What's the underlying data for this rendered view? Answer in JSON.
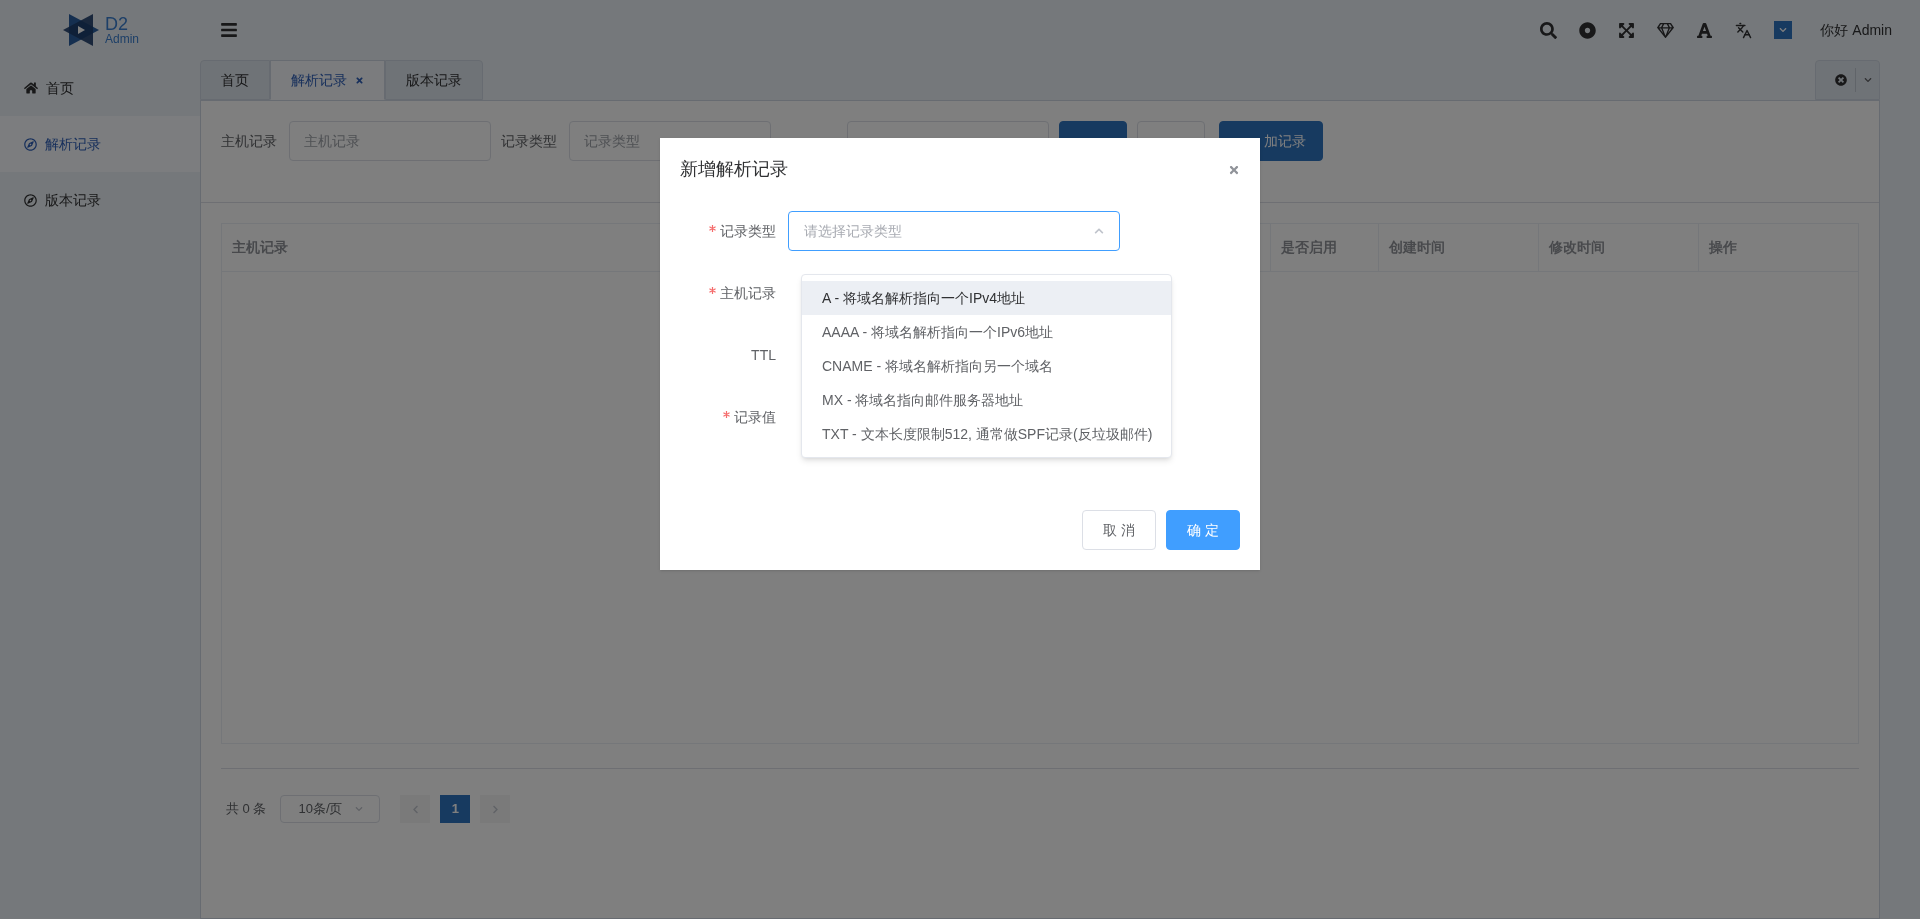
{
  "logo": {
    "title": "D2",
    "subtitle": "Admin"
  },
  "header": {
    "greeting": "你好 Admin"
  },
  "sidebar": {
    "items": [
      {
        "label": "首页",
        "selected": false
      },
      {
        "label": "解析记录",
        "selected": true
      },
      {
        "label": "版本记录",
        "selected": false
      }
    ]
  },
  "tabs": [
    {
      "label": "首页",
      "selected": false,
      "closable": false
    },
    {
      "label": "解析记录",
      "selected": true,
      "closable": true
    },
    {
      "label": "版本记录",
      "selected": false,
      "closable": false
    }
  ],
  "filters": [
    {
      "label": "主机记录",
      "placeholder": "主机记录"
    },
    {
      "label": "记录类型",
      "placeholder": "记录类型"
    }
  ],
  "filter_buttons": [
    {
      "kind": "primary"
    },
    {
      "kind": "default"
    },
    {
      "label": "加记录",
      "kind": "primary"
    }
  ],
  "table": {
    "columns": [
      "主机记录",
      "是否启用",
      "创建时间",
      "修改时间",
      "操作"
    ]
  },
  "pagination": {
    "total": "共 0 条",
    "page_size": "10条/页",
    "pages": [
      {
        "label": "1",
        "selected": true
      }
    ]
  },
  "dialog": {
    "title": "新增解析记录",
    "fields": [
      {
        "label": "记录类型",
        "required": true,
        "kind": "select",
        "placeholder": "请选择记录类型"
      },
      {
        "label": "主机记录",
        "required": true,
        "kind": "hidden"
      },
      {
        "label": "TTL",
        "required": false,
        "kind": "hidden"
      },
      {
        "label": "记录值",
        "required": true,
        "kind": "hidden"
      }
    ],
    "options": [
      {
        "label": "A - 将域名解析指向一个IPv4地址",
        "hovered": true
      },
      {
        "label": "AAAA - 将域名解析指向一个IPv6地址",
        "hovered": false
      },
      {
        "label": "CNAME - 将域名解析指向另一个域名",
        "hovered": false
      },
      {
        "label": "MX - 将域名指向邮件服务器地址",
        "hovered": false
      },
      {
        "label": "TXT - 文本长度限制512, 通常做SPF记录(反垃圾邮件)",
        "hovered": false
      }
    ],
    "buttons": [
      {
        "label": "取 消",
        "kind": "default"
      },
      {
        "label": "确 定",
        "kind": "primary"
      }
    ]
  }
}
